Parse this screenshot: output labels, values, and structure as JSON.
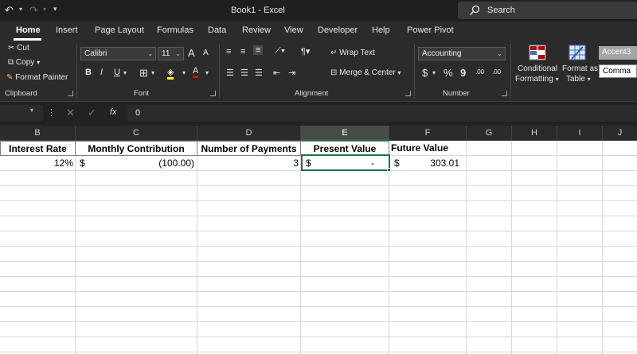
{
  "titlebar": {
    "undo_icon": "undo-icon",
    "redo_icon": "redo-icon",
    "title": "Book1  -  Excel",
    "search_placeholder": "Search"
  },
  "tabs": [
    "Home",
    "Insert",
    "Page Layout",
    "Formulas",
    "Data",
    "Review",
    "View",
    "Developer",
    "Help",
    "Power Pivot"
  ],
  "active_tab": "Home",
  "clipboard": {
    "cut": "Cut",
    "copy": "Copy",
    "format_painter": "Format Painter",
    "group": "Clipboard"
  },
  "font": {
    "name": "Calibri",
    "size": "11",
    "grow": "A",
    "shrink": "A",
    "bold": "B",
    "italic": "I",
    "underline": "U",
    "group": "Font"
  },
  "alignment": {
    "wrap_text": "Wrap Text",
    "merge_center": "Merge & Center",
    "group": "Alignment"
  },
  "number": {
    "format": "Accounting",
    "currency": "$",
    "percent": "%",
    "comma": "9",
    "inc_decimal": ".00",
    "dec_decimal": ".00",
    "group": "Number"
  },
  "styles": {
    "conditional_formatting_line1": "Conditional",
    "conditional_formatting_line2": "Formatting",
    "format_as_table_line1": "Format as",
    "format_as_table_line2": "Table",
    "accent3": "Accent3",
    "comma": "Comma"
  },
  "formula_bar": {
    "x": "✕",
    "check": "✓",
    "fx": "fx",
    "value": "0"
  },
  "columns": [
    {
      "label": "B",
      "selected": false
    },
    {
      "label": "C",
      "selected": false
    },
    {
      "label": "D",
      "selected": false
    },
    {
      "label": "E",
      "selected": true
    },
    {
      "label": "F",
      "selected": false
    },
    {
      "label": "G",
      "selected": false
    },
    {
      "label": "H",
      "selected": false
    },
    {
      "label": "I",
      "selected": false
    },
    {
      "label": "J",
      "selected": false
    }
  ],
  "headers": {
    "interest_rate": "Interest Rate",
    "monthly_contribution": "Monthly Contribution",
    "number_of_payments": "Number of Payments",
    "present_value": "Present Value",
    "future_value": "Future Value"
  },
  "row": {
    "interest_rate": "12%",
    "contribution_currency": "$",
    "contribution_amount": "(100.00)",
    "payments": "3",
    "pv_currency": "$",
    "pv_amount": "-",
    "fv_currency": "$",
    "fv_amount": "303.01"
  },
  "colors": {
    "ribbon_bg": "#2b2b2b",
    "titlebar_bg": "#1f1f1f",
    "selection": "#1e7145"
  }
}
